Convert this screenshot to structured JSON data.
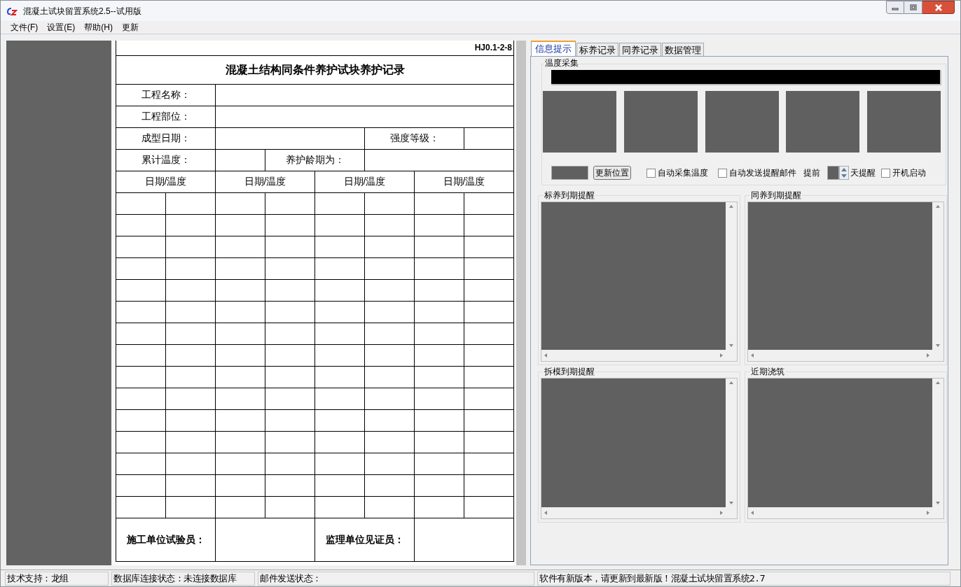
{
  "window": {
    "title": "混凝土试块留置系统2.5--试用版"
  },
  "menu": [
    "文件(F)",
    "设置(E)",
    "帮助(H)",
    "更新"
  ],
  "form": {
    "code": "HJ0.1-2-8",
    "title": "混凝土结构同条件养护试块养护记录",
    "labels": [
      "工程名称：",
      "工程部位：",
      "成型日期：",
      "强度等级：",
      "累计温度：",
      "养护龄期为："
    ],
    "column_headers": [
      "日期/温度",
      "日期/温度",
      "日期/温度",
      "日期/温度"
    ],
    "signatures": [
      "施工单位试验员：",
      "监理单位见证员："
    ]
  },
  "tabs": [
    {
      "label": "信息提示",
      "selected": true
    },
    {
      "label": "标养记录",
      "selected": false
    },
    {
      "label": "同养记录",
      "selected": false
    },
    {
      "label": "数据管理",
      "selected": false
    }
  ],
  "temperature_group": {
    "title": "温度采集",
    "update_button": "更新位置",
    "checkboxes": [
      {
        "label": "自动采集温度",
        "checked": false
      },
      {
        "label": "自动发送提醒邮件",
        "checked": false
      }
    ],
    "advance_label": "提前",
    "days_label": "天提醒",
    "startup": {
      "label": "开机启动",
      "checked": false
    }
  },
  "lists": [
    {
      "title": "标养到期提醒"
    },
    {
      "title": "同养到期提醒"
    },
    {
      "title": "拆模到期提醒"
    },
    {
      "title": "近期浇筑"
    }
  ],
  "status_bar": [
    "技术支持：龙组",
    "数据库连接状态：未连接数据库",
    "邮件发送状态：",
    "软件有新版本，请更新到最新版！混凝土试块留置系统2.7"
  ]
}
